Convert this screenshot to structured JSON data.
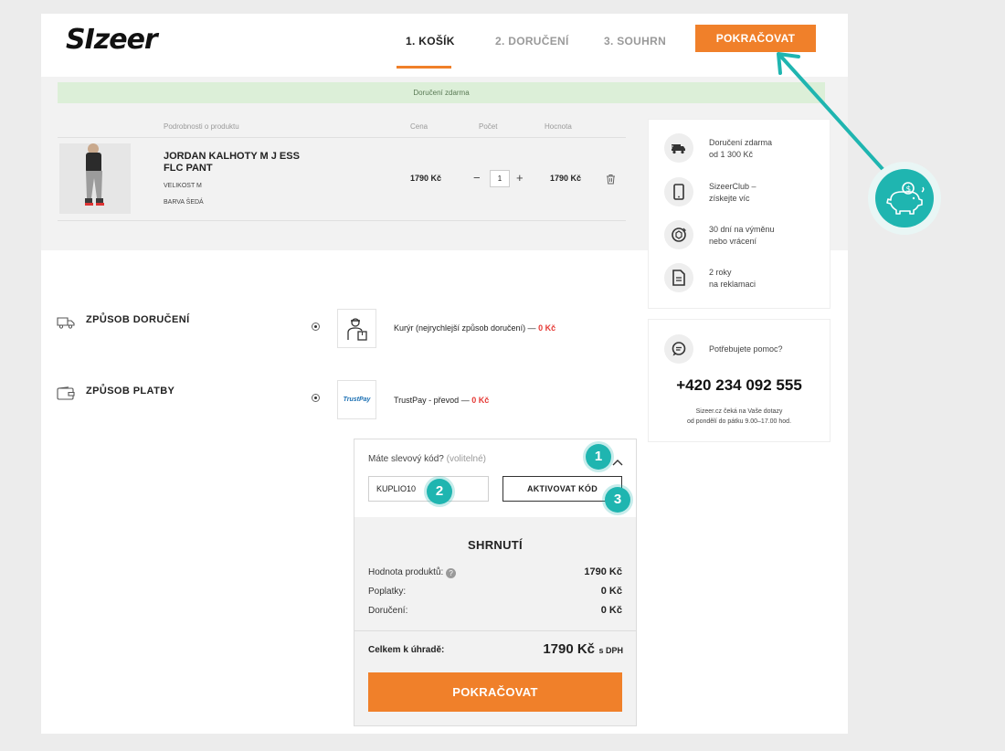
{
  "brand": {
    "logo": "SIzeer"
  },
  "steps": [
    {
      "label": "1. KOŠÍK"
    },
    {
      "label": "2. DORUČENÍ"
    },
    {
      "label": "3. SOUHRN"
    }
  ],
  "header": {
    "continue_label": "POKRAČOVAT"
  },
  "banner": {
    "text": "Doručení zdarma"
  },
  "cart": {
    "columns": {
      "details": "Podrobnosti o produktu",
      "price": "Cena",
      "count": "Počet",
      "value": "Hocnota"
    },
    "item": {
      "name": "JORDAN KALHOTY M J ESS FLC PANT",
      "size": "VELIKOST M",
      "color": "BARVA ŠEDÁ",
      "price": "1790 Kč",
      "qty": "1",
      "minus": "−",
      "plus": "+",
      "total": "1790 Kč"
    }
  },
  "benefits": [
    {
      "icon": "truck-icon",
      "line1": "Doručení zdarma",
      "line2": "od 1 300 Kč"
    },
    {
      "icon": "phone-icon",
      "line1": "SizeerClub –",
      "line2": "získejte víc"
    },
    {
      "icon": "return-icon",
      "line1": "30 dní na výměnu",
      "line2": "nebo vrácení"
    },
    {
      "icon": "document-icon",
      "line1": "2 roky",
      "line2": "na reklamaci"
    }
  ],
  "help": {
    "question": "Potřebujete pomoc?",
    "phone": "+420 234 092 555",
    "note1": "Sizeer.cz čeká na Vaše dotazy",
    "note2": "od pondělí do pátku 9.00–17.00 hod."
  },
  "delivery": {
    "title": "ZPŮSOB DORUČENÍ",
    "option": "Kurýr (nejrychlejší způsob doručení) —",
    "price": "0 Kč"
  },
  "payment": {
    "title": "ZPŮSOB PLATBY",
    "logo": "TrustPay",
    "option": "TrustPay - převod —",
    "price": "0 Kč"
  },
  "discount": {
    "label": "Máte slevový kód?",
    "optional": "(volitelné)",
    "value": "KUPLIO10",
    "activate_label": "AKTIVOVAT KÓD"
  },
  "summary": {
    "title": "SHRNUTÍ",
    "rows": [
      {
        "label": "Hodnota produktů:",
        "value": "1790 Kč"
      },
      {
        "label": "Poplatky:",
        "value": "0 Kč"
      },
      {
        "label": "Doručení:",
        "value": "0 Kč"
      }
    ],
    "total_label": "Celkem k úhradě:",
    "total_value": "1790 Kč",
    "total_suffix": "s DPH",
    "continue_label": "POKRAČOVAT"
  },
  "badges": [
    "1",
    "2",
    "3"
  ],
  "colors": {
    "accent": "#f0802a",
    "teal": "#1fb5b0",
    "banner": "#dcefd8",
    "price_red": "#e53935"
  }
}
